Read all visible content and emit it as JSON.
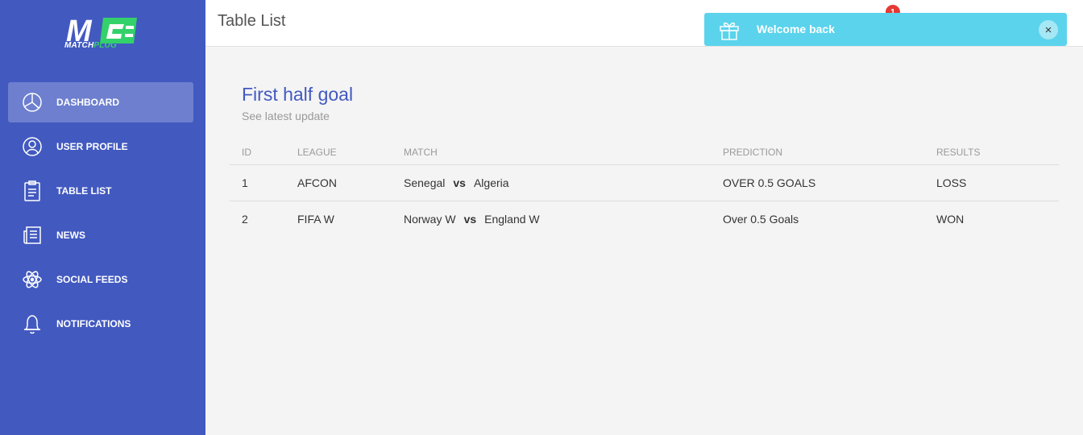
{
  "brand": {
    "logo_letters": "M",
    "name_part1": "MATCH",
    "name_part2": "PLUG",
    "accent": "#33d16a"
  },
  "sidebar": {
    "items": [
      {
        "label": "DASHBOARD",
        "icon": "pie-chart-icon",
        "active": true
      },
      {
        "label": "USER PROFILE",
        "icon": "user-icon",
        "active": false
      },
      {
        "label": "TABLE LIST",
        "icon": "clipboard-icon",
        "active": false
      },
      {
        "label": "NEWS",
        "icon": "newspaper-icon",
        "active": false
      },
      {
        "label": "SOCIAL FEEDS",
        "icon": "atom-icon",
        "active": false
      },
      {
        "label": "NOTIFICATIONS",
        "icon": "bell-icon",
        "active": false
      }
    ]
  },
  "header": {
    "title": "Table List",
    "notification_count": "1"
  },
  "toast": {
    "message": "Welcome back",
    "close": "×"
  },
  "card": {
    "title": "First half goal",
    "subtitle": "See latest update",
    "columns": [
      "ID",
      "LEAGUE",
      "MATCH",
      "PREDICTION",
      "RESULTS"
    ],
    "rows": [
      {
        "id": "1",
        "league": "AFCON",
        "home": "Senegal",
        "vs": "vs",
        "away": "Algeria",
        "prediction": "OVER 0.5 GOALS",
        "result": "LOSS"
      },
      {
        "id": "2",
        "league": "FIFA W",
        "home": "Norway W",
        "vs": "vs",
        "away": "England W",
        "prediction": "Over 0.5 Goals",
        "result": "WON"
      }
    ]
  },
  "colors": {
    "sidebar_bg": "#4259c0",
    "toast_bg": "#5bd3ec",
    "badge": "#e53935"
  }
}
